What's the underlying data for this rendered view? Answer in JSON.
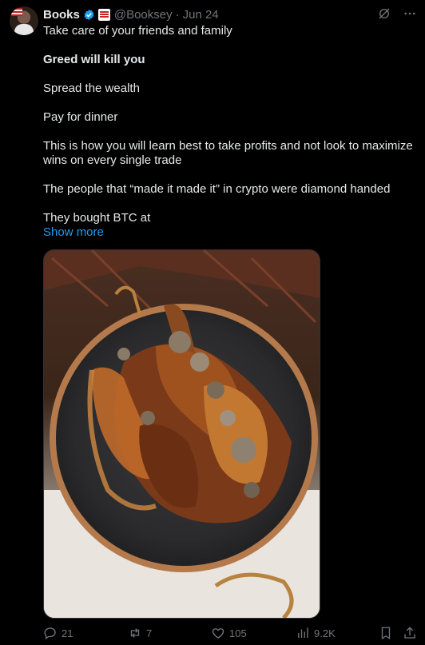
{
  "author": {
    "name": "Books",
    "handle": "@Booksey",
    "separator": "·",
    "date": "Jun 24"
  },
  "icons": {
    "verified": "verified-check-icon",
    "grok": "grok-icon",
    "more": "more-options-icon",
    "reply": "reply-icon",
    "repost": "repost-icon",
    "like": "like-icon",
    "views": "views-icon",
    "bookmark": "bookmark-icon",
    "share": "share-icon"
  },
  "post": {
    "lines": [
      "Take care of your friends and family",
      "Greed will kill you",
      "Spread the wealth",
      "Pay for dinner",
      "This is how you will learn best to take profits and not look to maximize wins on every single trade",
      "The people that “made it made it” in crypto were diamond handed",
      "They bought BTC at"
    ],
    "show_more": "Show more"
  },
  "stats": {
    "replies": "21",
    "reposts": "7",
    "likes": "105",
    "views": "9.2K"
  },
  "colors": {
    "background": "#000000",
    "text": "#e7e9ea",
    "muted": "#71767b",
    "link": "#1d9bf0",
    "verified": "#1d9bf0"
  }
}
